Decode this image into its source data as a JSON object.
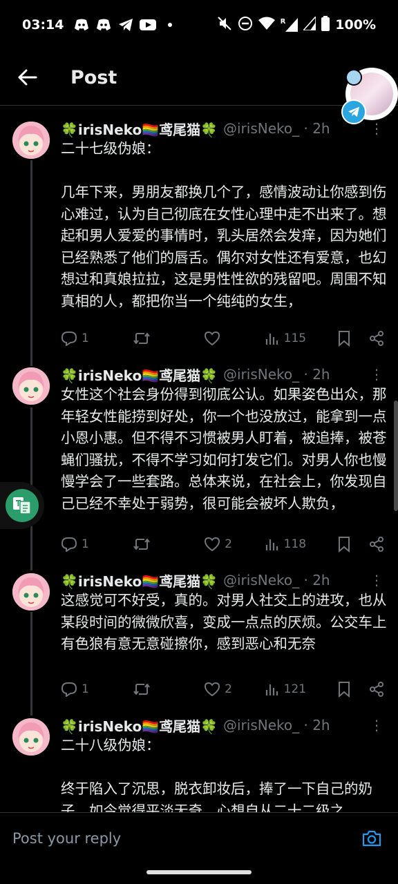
{
  "status": {
    "time": "03:14",
    "battery": "100%",
    "network_label": "R"
  },
  "header": {
    "title": "Post"
  },
  "reply": {
    "placeholder": "Post your reply"
  },
  "colors": {
    "accent": "#1d9bf0",
    "muted": "#71767b",
    "background": "#000000"
  },
  "tweets": [
    {
      "name": "🍀irisNeko🏳️‍🌈鸢尾猫🍀",
      "handle": "@irisNeko_ · 2h",
      "text": "二十七级伪娘：\n\n几年下来，男朋友都换几个了，感情波动让你感到伤心难过，认为自己彻底在女性心理中走不出来了。想起和男人爱爱的事情时，乳头居然会发痒，因为她们已经熟悉了他们的唇舌。偶尔对女性还有爱意，也幻想过和真娘拉拉，这是男性性欲的残留吧。周围不知真相的人，都把你当一个纯纯的女生，",
      "replies": "1",
      "reposts": "",
      "likes": "",
      "views": "115"
    },
    {
      "name": "🍀irisNeko🏳️‍🌈鸢尾猫🍀",
      "handle": "@irisNeko_ · 2h",
      "text": "女性这个社会身份得到彻底公认。如果姿色出众，那年轻女性能捞到好处，你一个也没放过，能拿到一点小恩小惠。但不得不习惯被男人盯着，被追捧，被苍蝇们骚扰，不得不学习如何打发它们。对男人你也慢慢学会了一些套路。总体来说，在社会上，你发现自己已经不幸处于弱势，很可能会被坏人欺负，",
      "replies": "1",
      "reposts": "",
      "likes": "2",
      "views": "118"
    },
    {
      "name": "🍀irisNeko🏳️‍🌈鸢尾猫🍀",
      "handle": "@irisNeko_ · 2h",
      "text": "这感觉可不好受，真的。对男人社交上的进攻，也从某段时间的微微欣喜，变成一点点的厌烦。公交车上有色狼有意无意碰擦你，感到恶心和无奈",
      "replies": "1",
      "reposts": "",
      "likes": "2",
      "views": "121"
    },
    {
      "name": "🍀irisNeko🏳️‍🌈鸢尾猫🍀",
      "handle": "@irisNeko_ · 2h",
      "text": "二十八级伪娘：\n\n终于陷入了沉思，脱衣卸妆后，捧了一下自己的奶子，如今觉得平淡无奇。心想自从二十二级之",
      "replies": "",
      "reposts": "",
      "likes": "",
      "views": ""
    }
  ]
}
